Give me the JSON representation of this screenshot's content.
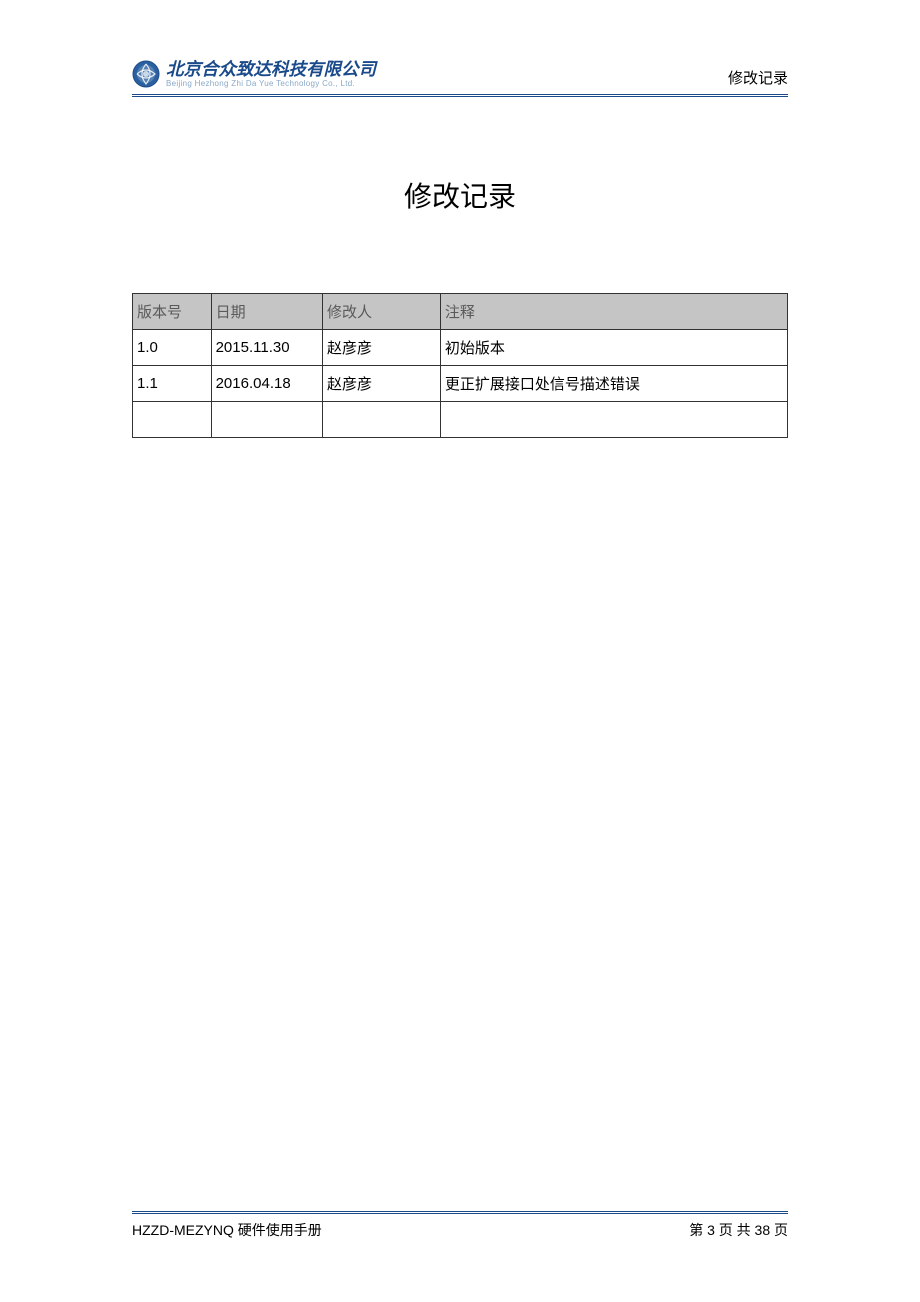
{
  "header": {
    "company_zh": "北京合众致达科技有限公司",
    "company_en": "Beijing Hezhong Zhi Da Yue Technology Co., Ltd.",
    "section_label": "修改记录"
  },
  "title": "修改记录",
  "table": {
    "headers": [
      "版本号",
      "日期",
      "修改人",
      "注释"
    ],
    "rows": [
      {
        "version": "1.0",
        "date": "2015.11.30",
        "author": "赵彦彦",
        "note": "初始版本"
      },
      {
        "version": "1.1",
        "date": "2016.04.18",
        "author": "赵彦彦",
        "note": "更正扩展接口处信号描述错误"
      },
      {
        "version": "",
        "date": "",
        "author": "",
        "note": ""
      }
    ]
  },
  "footer": {
    "doc_title": "HZZD-MEZYNQ 硬件使用手册",
    "page_info": "第 3 页 共 38 页"
  }
}
